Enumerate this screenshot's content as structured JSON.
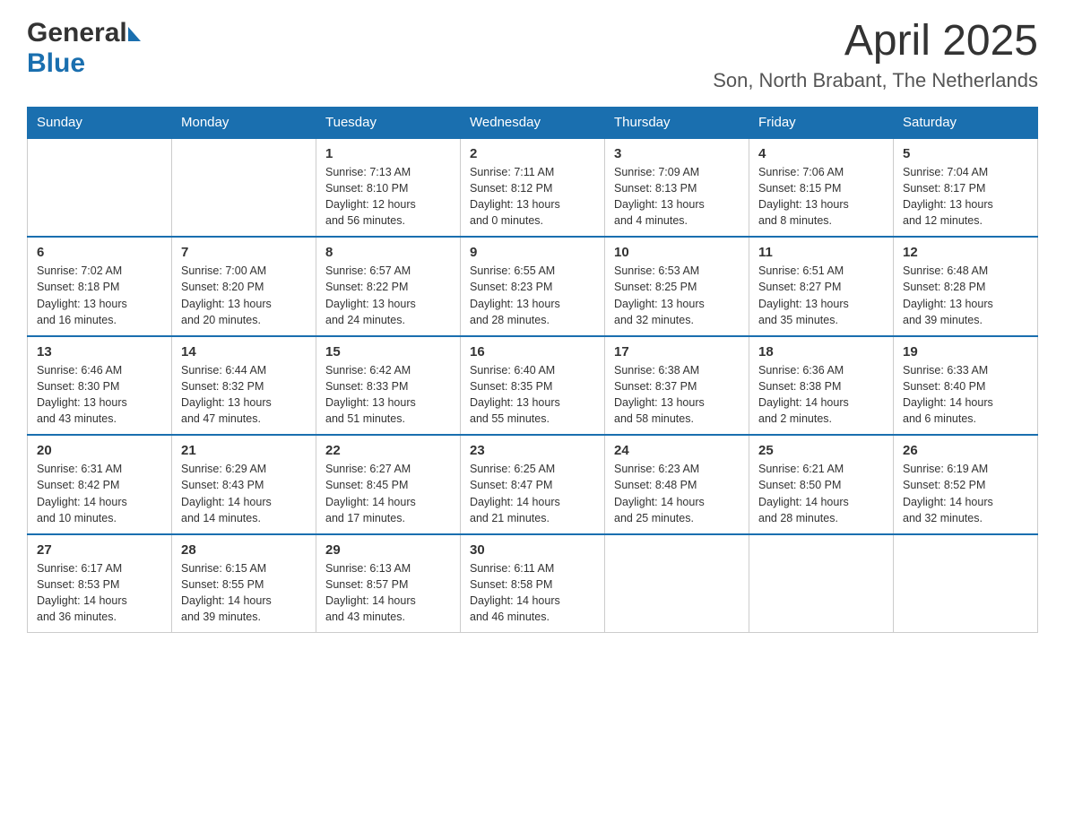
{
  "header": {
    "logo_general": "General",
    "logo_blue": "Blue",
    "title": "April 2025",
    "subtitle": "Son, North Brabant, The Netherlands"
  },
  "days_of_week": [
    "Sunday",
    "Monday",
    "Tuesday",
    "Wednesday",
    "Thursday",
    "Friday",
    "Saturday"
  ],
  "weeks": [
    [
      {
        "day": "",
        "info": ""
      },
      {
        "day": "",
        "info": ""
      },
      {
        "day": "1",
        "info": "Sunrise: 7:13 AM\nSunset: 8:10 PM\nDaylight: 12 hours\nand 56 minutes."
      },
      {
        "day": "2",
        "info": "Sunrise: 7:11 AM\nSunset: 8:12 PM\nDaylight: 13 hours\nand 0 minutes."
      },
      {
        "day": "3",
        "info": "Sunrise: 7:09 AM\nSunset: 8:13 PM\nDaylight: 13 hours\nand 4 minutes."
      },
      {
        "day": "4",
        "info": "Sunrise: 7:06 AM\nSunset: 8:15 PM\nDaylight: 13 hours\nand 8 minutes."
      },
      {
        "day": "5",
        "info": "Sunrise: 7:04 AM\nSunset: 8:17 PM\nDaylight: 13 hours\nand 12 minutes."
      }
    ],
    [
      {
        "day": "6",
        "info": "Sunrise: 7:02 AM\nSunset: 8:18 PM\nDaylight: 13 hours\nand 16 minutes."
      },
      {
        "day": "7",
        "info": "Sunrise: 7:00 AM\nSunset: 8:20 PM\nDaylight: 13 hours\nand 20 minutes."
      },
      {
        "day": "8",
        "info": "Sunrise: 6:57 AM\nSunset: 8:22 PM\nDaylight: 13 hours\nand 24 minutes."
      },
      {
        "day": "9",
        "info": "Sunrise: 6:55 AM\nSunset: 8:23 PM\nDaylight: 13 hours\nand 28 minutes."
      },
      {
        "day": "10",
        "info": "Sunrise: 6:53 AM\nSunset: 8:25 PM\nDaylight: 13 hours\nand 32 minutes."
      },
      {
        "day": "11",
        "info": "Sunrise: 6:51 AM\nSunset: 8:27 PM\nDaylight: 13 hours\nand 35 minutes."
      },
      {
        "day": "12",
        "info": "Sunrise: 6:48 AM\nSunset: 8:28 PM\nDaylight: 13 hours\nand 39 minutes."
      }
    ],
    [
      {
        "day": "13",
        "info": "Sunrise: 6:46 AM\nSunset: 8:30 PM\nDaylight: 13 hours\nand 43 minutes."
      },
      {
        "day": "14",
        "info": "Sunrise: 6:44 AM\nSunset: 8:32 PM\nDaylight: 13 hours\nand 47 minutes."
      },
      {
        "day": "15",
        "info": "Sunrise: 6:42 AM\nSunset: 8:33 PM\nDaylight: 13 hours\nand 51 minutes."
      },
      {
        "day": "16",
        "info": "Sunrise: 6:40 AM\nSunset: 8:35 PM\nDaylight: 13 hours\nand 55 minutes."
      },
      {
        "day": "17",
        "info": "Sunrise: 6:38 AM\nSunset: 8:37 PM\nDaylight: 13 hours\nand 58 minutes."
      },
      {
        "day": "18",
        "info": "Sunrise: 6:36 AM\nSunset: 8:38 PM\nDaylight: 14 hours\nand 2 minutes."
      },
      {
        "day": "19",
        "info": "Sunrise: 6:33 AM\nSunset: 8:40 PM\nDaylight: 14 hours\nand 6 minutes."
      }
    ],
    [
      {
        "day": "20",
        "info": "Sunrise: 6:31 AM\nSunset: 8:42 PM\nDaylight: 14 hours\nand 10 minutes."
      },
      {
        "day": "21",
        "info": "Sunrise: 6:29 AM\nSunset: 8:43 PM\nDaylight: 14 hours\nand 14 minutes."
      },
      {
        "day": "22",
        "info": "Sunrise: 6:27 AM\nSunset: 8:45 PM\nDaylight: 14 hours\nand 17 minutes."
      },
      {
        "day": "23",
        "info": "Sunrise: 6:25 AM\nSunset: 8:47 PM\nDaylight: 14 hours\nand 21 minutes."
      },
      {
        "day": "24",
        "info": "Sunrise: 6:23 AM\nSunset: 8:48 PM\nDaylight: 14 hours\nand 25 minutes."
      },
      {
        "day": "25",
        "info": "Sunrise: 6:21 AM\nSunset: 8:50 PM\nDaylight: 14 hours\nand 28 minutes."
      },
      {
        "day": "26",
        "info": "Sunrise: 6:19 AM\nSunset: 8:52 PM\nDaylight: 14 hours\nand 32 minutes."
      }
    ],
    [
      {
        "day": "27",
        "info": "Sunrise: 6:17 AM\nSunset: 8:53 PM\nDaylight: 14 hours\nand 36 minutes."
      },
      {
        "day": "28",
        "info": "Sunrise: 6:15 AM\nSunset: 8:55 PM\nDaylight: 14 hours\nand 39 minutes."
      },
      {
        "day": "29",
        "info": "Sunrise: 6:13 AM\nSunset: 8:57 PM\nDaylight: 14 hours\nand 43 minutes."
      },
      {
        "day": "30",
        "info": "Sunrise: 6:11 AM\nSunset: 8:58 PM\nDaylight: 14 hours\nand 46 minutes."
      },
      {
        "day": "",
        "info": ""
      },
      {
        "day": "",
        "info": ""
      },
      {
        "day": "",
        "info": ""
      }
    ]
  ]
}
